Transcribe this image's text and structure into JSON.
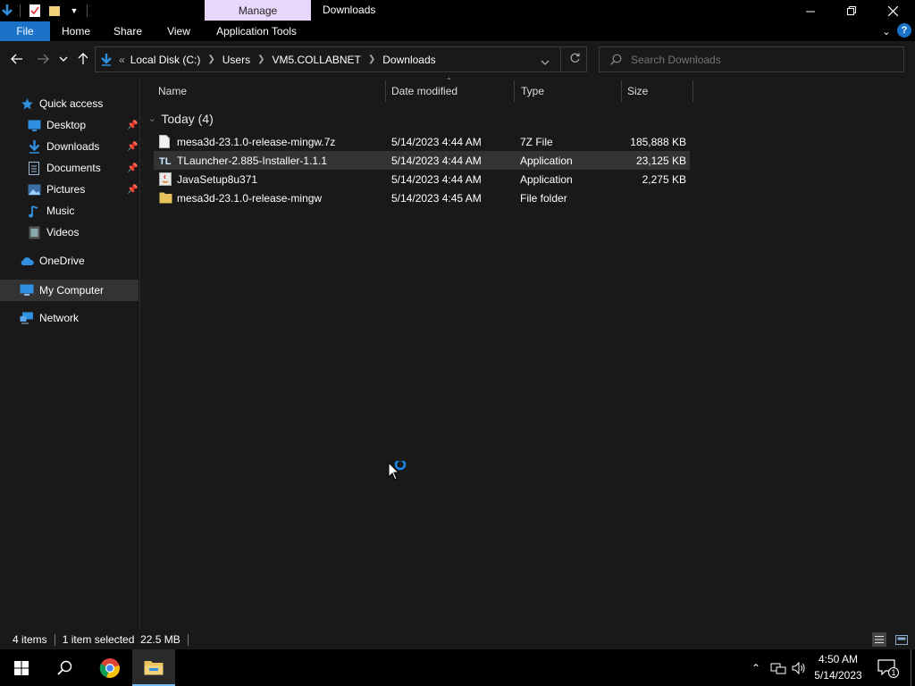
{
  "titlebar": {
    "context_tab": "Manage",
    "title": "Downloads",
    "quick_access_icons": [
      "down-arrow-icon",
      "properties-icon",
      "new-folder-icon",
      "customize-dropdown-icon"
    ]
  },
  "ribbon": {
    "tabs": [
      "File",
      "Home",
      "Share",
      "View",
      "Application Tools"
    ]
  },
  "address": {
    "overflow": "«",
    "crumbs": [
      "Local Disk (C:)",
      "Users",
      "VM5.COLLABNET",
      "Downloads"
    ]
  },
  "search": {
    "placeholder": "Search Downloads"
  },
  "nav": {
    "quick_access": "Quick access",
    "pinned": [
      "Desktop",
      "Downloads",
      "Documents",
      "Pictures"
    ],
    "unpinned": [
      "Music",
      "Videos"
    ],
    "onedrive": "OneDrive",
    "my_computer": "My Computer",
    "network": "Network"
  },
  "columns": {
    "name": "Name",
    "date": "Date modified",
    "type": "Type",
    "size": "Size"
  },
  "group": {
    "label": "Today (4)"
  },
  "files": [
    {
      "name": "mesa3d-23.1.0-release-mingw.7z",
      "date": "5/14/2023 4:44 AM",
      "type": "7Z File",
      "size": "185,888 KB",
      "icon": "archive-file-icon"
    },
    {
      "name": "TLauncher-2.885-Installer-1.1.1",
      "date": "5/14/2023 4:44 AM",
      "type": "Application",
      "size": "23,125 KB",
      "icon": "tlauncher-icon"
    },
    {
      "name": "JavaSetup8u371",
      "date": "5/14/2023 4:44 AM",
      "type": "Application",
      "size": "2,275 KB",
      "icon": "java-icon"
    },
    {
      "name": "mesa3d-23.1.0-release-mingw",
      "date": "5/14/2023 4:45 AM",
      "type": "File folder",
      "size": "",
      "icon": "folder-icon"
    }
  ],
  "status": {
    "count": "4 items",
    "selected": "1 item selected  22.5 MB"
  },
  "taskbar": {
    "time": "4:50 AM",
    "date": "5/14/2023",
    "notifications": "1"
  },
  "colors": {
    "accent": "#1a73c9",
    "manage_tab": "#e8d7fb",
    "selection": "#333333",
    "folder": "#e8c25a"
  }
}
